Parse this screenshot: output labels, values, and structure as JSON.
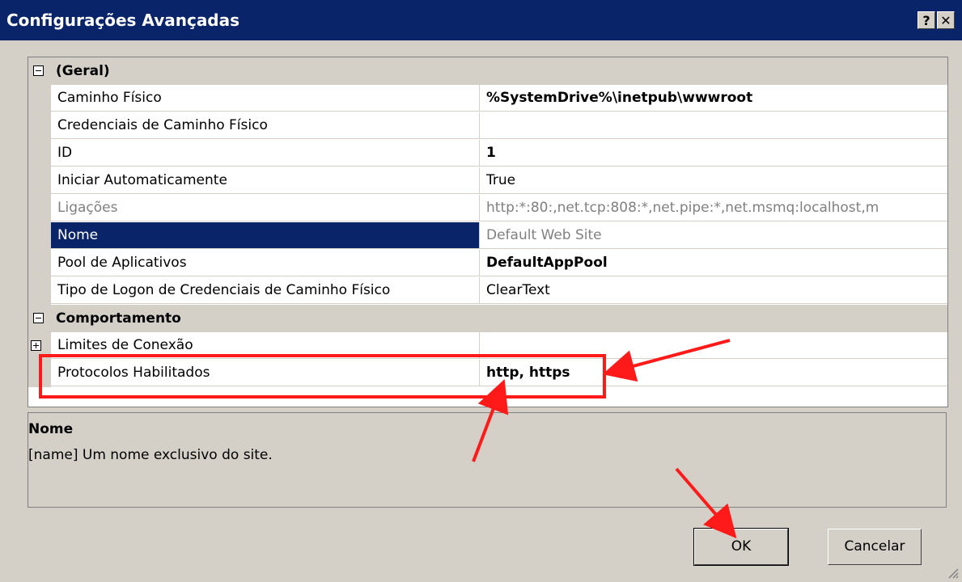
{
  "window": {
    "title": "Configurações Avançadas",
    "help_button": "?",
    "close_button": "✕"
  },
  "grid": {
    "categories": [
      {
        "label": "(Geral)",
        "properties": [
          {
            "name": "Caminho Físico",
            "value": "%SystemDrive%\\inetpub\\wwwroot"
          },
          {
            "name": "Credenciais de Caminho Físico",
            "value": ""
          },
          {
            "name": "ID",
            "value": "1"
          },
          {
            "name": "Iniciar Automaticamente",
            "value": "True"
          },
          {
            "name": "Ligações",
            "value": "http:*:80:,net.tcp:808:*,net.pipe:*,net.msmq:localhost,m"
          },
          {
            "name": "Nome",
            "value": "Default Web Site"
          },
          {
            "name": "Pool de Aplicativos",
            "value": "DefaultAppPool"
          },
          {
            "name": "Tipo de Logon de Credenciais de Caminho Físico",
            "value": "ClearText"
          }
        ]
      },
      {
        "label": "Comportamento",
        "properties": [
          {
            "name": "Limites de Conexão",
            "value": ""
          },
          {
            "name": "Protocolos Habilitados",
            "value": "http, https"
          }
        ]
      }
    ]
  },
  "description": {
    "title": "Nome",
    "text": "[name] Um nome exclusivo do site."
  },
  "buttons": {
    "ok": "OK",
    "cancel": "Cancelar"
  },
  "colors": {
    "titlebar": "#0a246a",
    "dialog": "#d4d0c8",
    "annotation": "#ff1a1a"
  }
}
